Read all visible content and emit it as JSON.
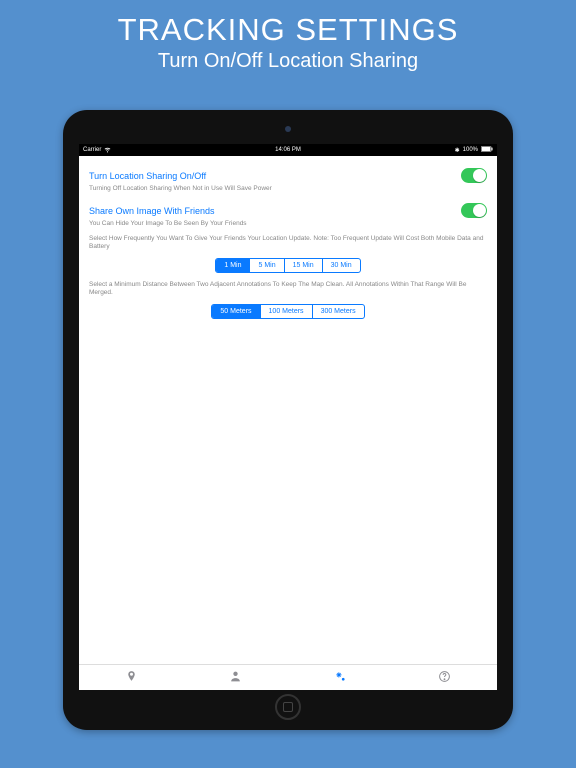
{
  "hero": {
    "title": "TRACKING SETTINGS",
    "subtitle": "Turn On/Off Location Sharing"
  },
  "status": {
    "carrier": "Carrier",
    "time": "14:06 PM",
    "battery": "100%"
  },
  "settings": {
    "location_toggle": {
      "label": "Turn Location Sharing On/Off",
      "desc": "Turning Off Location Sharing When Not in Use Will Save Power",
      "on": true
    },
    "image_toggle": {
      "label": "Share Own Image With Friends",
      "desc": "You Can Hide Your Image To Be Seen By Your Friends",
      "on": true
    },
    "frequency": {
      "desc": "Select How Frequently You Want To Give Your Friends Your Location Update. Note: Too Frequent Update Will Cost Both Mobile Data and Battery",
      "options": [
        "1 Min",
        "5 Min",
        "15 Min",
        "30 Min"
      ],
      "selected": 0
    },
    "distance": {
      "desc": "Select a Minimum Distance Between Two Adjacent Annotations To Keep The Map Clean. All Annotations Within That Range Will Be Merged.",
      "options": [
        "50 Meters",
        "100 Meters",
        "300 Meters"
      ],
      "selected": 0
    }
  }
}
